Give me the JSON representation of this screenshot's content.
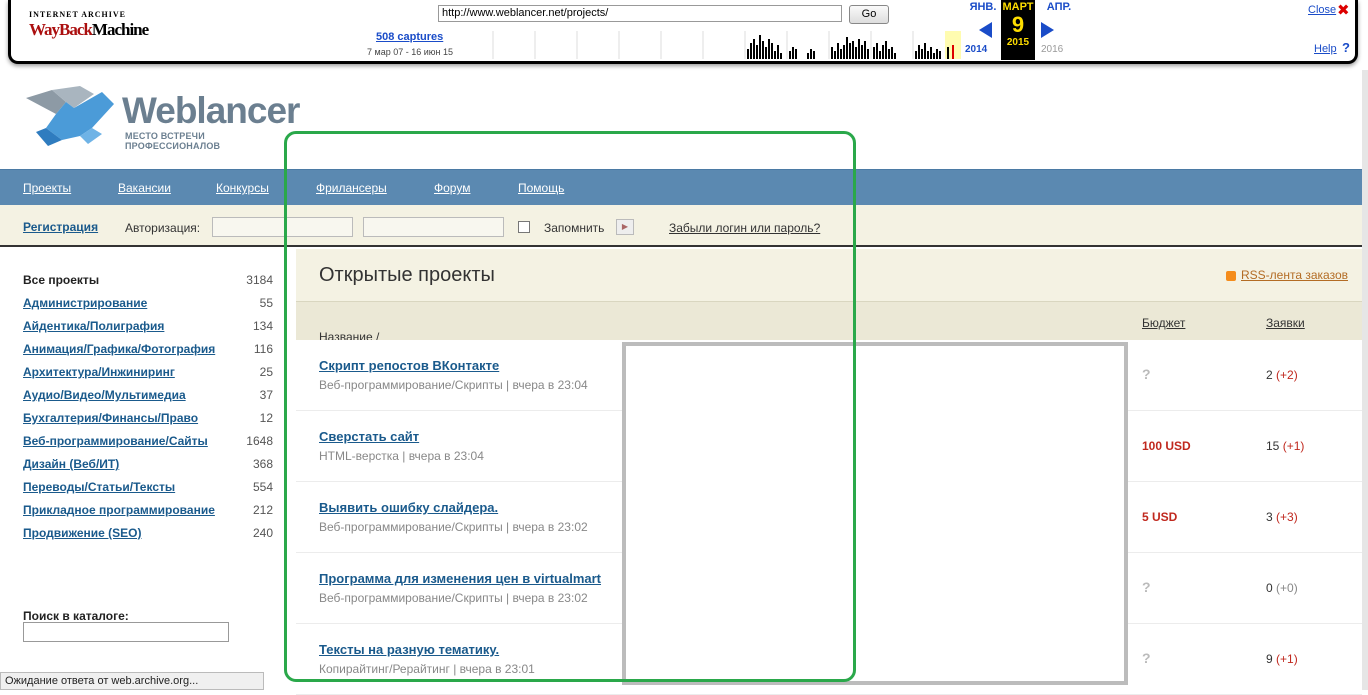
{
  "wayback": {
    "logo_top": "INTERNET ARCHIVE",
    "logo_way": "WayBack",
    "logo_machine": "Machine",
    "url": "http://www.weblancer.net/projects/",
    "go_label": "Go",
    "captures": "508 captures",
    "range": "7 мар 07 - 16 июн 15",
    "prev_month": "ЯНВ.",
    "cur_month": "МАРТ",
    "cur_day": "9",
    "cur_year": "2015",
    "next_month": "АПР.",
    "prev_year": "2014",
    "next_year": "2016",
    "close_label": "Close",
    "help_label": "Help"
  },
  "site": {
    "brand": "Weblancer",
    "tagline": "МЕСТО ВСТРЕЧИ ПРОФЕССИОНАЛОВ"
  },
  "nav": [
    "Проекты",
    "Вакансии",
    "Конкурсы",
    "Фрилансеры",
    "Форум",
    "Помощь"
  ],
  "auth": {
    "register": "Регистрация",
    "auth_label": "Авторизация:",
    "remember": "Запомнить",
    "forgot": "Забыли логин или пароль?"
  },
  "sidebar": {
    "categories": [
      {
        "name": "Все проекты",
        "count": "3184"
      },
      {
        "name": "Администрирование",
        "count": "55"
      },
      {
        "name": "Айдентика/Полиграфия",
        "count": "134"
      },
      {
        "name": "Анимация/Графика/Фотография",
        "count": "116"
      },
      {
        "name": "Архитектура/Инжиниринг",
        "count": "25"
      },
      {
        "name": "Аудио/Видео/Мультимедиа",
        "count": "37"
      },
      {
        "name": "Бухгалтерия/Финансы/Право",
        "count": "12"
      },
      {
        "name": "Веб-программирование/Сайты",
        "count": "1648"
      },
      {
        "name": "Дизайн (Веб/ИТ)",
        "count": "368"
      },
      {
        "name": "Переводы/Статьи/Тексты",
        "count": "554"
      },
      {
        "name": "Прикладное программирование",
        "count": "212"
      },
      {
        "name": "Продвижение (SEO)",
        "count": "240"
      }
    ],
    "search_label": "Поиск в каталоге:"
  },
  "main": {
    "title": "Открытые проекты",
    "rss": "RSS-лента заказов",
    "col_name": "Название / Категория / Время публикации",
    "col_sort": "↓",
    "col_budget": "Бюджет",
    "col_bids": "Заявки",
    "projects": [
      {
        "title": "Скрипт репостов ВКонтакте",
        "meta": "Веб-программирование/Скрипты | вчера в 23:04",
        "budget": "?",
        "bids": "2",
        "bids_delta": "(+2)"
      },
      {
        "title": "Сверстать сайт",
        "meta": "HTML-верстка | вчера в 23:04",
        "budget": "100 USD",
        "bids": "15",
        "bids_delta": "(+1)"
      },
      {
        "title": "Выявить ошибку слайдера.",
        "meta": "Веб-программирование/Скрипты | вчера в 23:02",
        "budget": "5 USD",
        "bids": "3",
        "bids_delta": "(+3)"
      },
      {
        "title": "Программа для изменения цен в virtualmart",
        "meta": "Веб-программирование/Скрипты | вчера в 23:02",
        "budget": "?",
        "bids": "0",
        "bids_delta": "(+0)"
      },
      {
        "title": "Тексты на разную тематику.",
        "meta": "Копирайтинг/Рерайтинг | вчера в 23:01",
        "budget": "?",
        "bids": "9",
        "bids_delta": "(+1)"
      }
    ]
  },
  "status_text": "Ожидание ответа от web.archive.org...",
  "colors": {
    "nav": "#5b89b1",
    "accent_red": "#c0281e",
    "overlay_green": "#2aa84a",
    "overlay_gray": "#bcbcbc"
  }
}
